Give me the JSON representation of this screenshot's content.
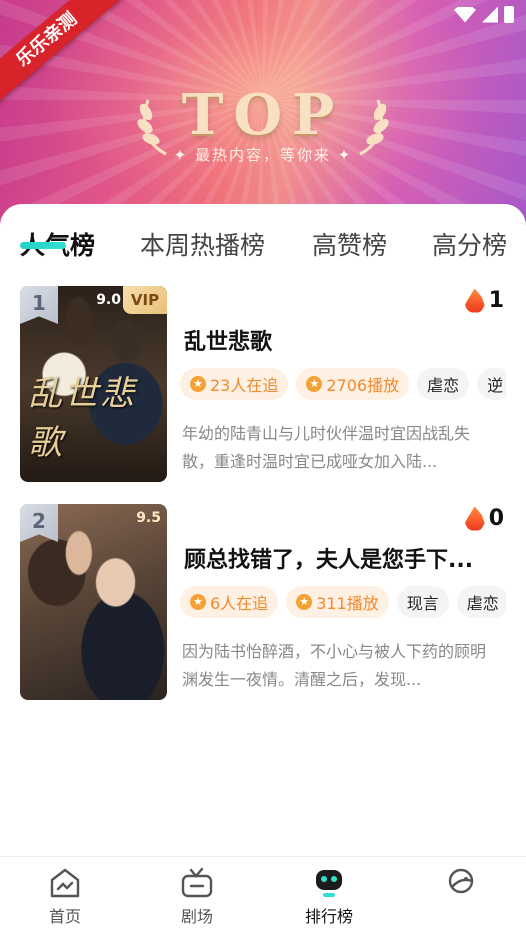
{
  "banner": {
    "ribbon_text": "乐乐亲测",
    "logo_text": "TOP",
    "subtitle": "✦ 最热内容，等你来 ✦"
  },
  "tabs": [
    {
      "label": "人气榜",
      "active": true
    },
    {
      "label": "本周热播榜",
      "active": false
    },
    {
      "label": "高赞榜",
      "active": false
    },
    {
      "label": "高分榜",
      "active": false
    }
  ],
  "dramas": [
    {
      "rank": "1",
      "score": "9.0",
      "badge": "VIP",
      "poster_text": "乱世悲歌",
      "heat": "1",
      "title": "乱世悲歌",
      "followers": "23人在追",
      "plays": "2706播放",
      "tags": [
        "虐恋",
        "逆"
      ],
      "description": "年幼的陆青山与儿时伙伴温时宜因战乱失散，重逢时温时宜已成哑女加入陆..."
    },
    {
      "rank": "2",
      "score": "9.5",
      "badge": "",
      "poster_text": "",
      "heat": "0",
      "title": "顾总找错了，夫人是您手下...",
      "followers": "6人在追",
      "plays": "311播放",
      "tags": [
        "现言",
        "虐恋"
      ],
      "description": "因为陆书怡醉酒，不小心与被人下药的顾明渊发生一夜情。清醒之后，发现..."
    }
  ],
  "bottom_nav": [
    {
      "label": "首页",
      "icon": "home-icon",
      "active": false
    },
    {
      "label": "剧场",
      "icon": "tv-icon",
      "active": false
    },
    {
      "label": "排行榜",
      "icon": "ranking-robot-icon",
      "active": true
    },
    {
      "label": "",
      "icon": "profile-icon",
      "active": false
    }
  ],
  "colors": {
    "accent": "#22d3c5",
    "tag_orange": "#f28a2e",
    "ribbon": "#d8232a"
  }
}
